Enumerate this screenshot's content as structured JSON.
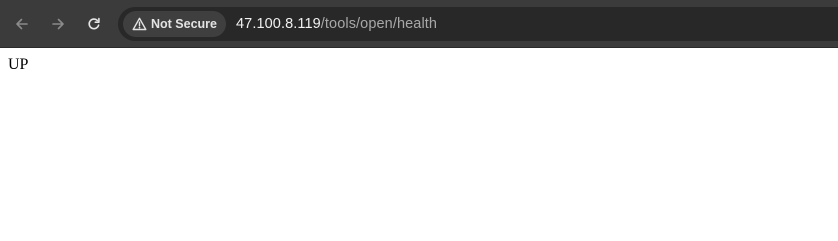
{
  "toolbar": {
    "back_icon": "back-arrow-icon",
    "forward_icon": "forward-arrow-icon",
    "reload_icon": "reload-icon"
  },
  "address_bar": {
    "security_icon": "warning-triangle-icon",
    "security_label": "Not Secure",
    "url_host": "47.100.8.119",
    "url_path": "/tools/open/health"
  },
  "page": {
    "body_text": "UP"
  },
  "colors": {
    "toolbar_bg": "#3b3b3b",
    "omnibox_bg": "#282828",
    "chip_bg": "#3f3f3f",
    "page_bg": "#ffffff"
  }
}
